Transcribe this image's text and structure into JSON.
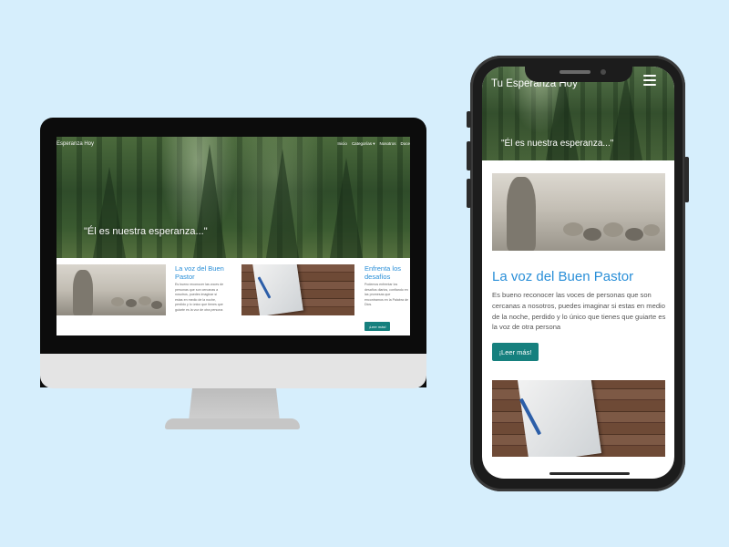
{
  "site": {
    "brand": "Tu Esperanza Hoy",
    "desktop_brand": "Esperanza Hoy",
    "hero_quote": "\"Él es nuestra esperanza...\""
  },
  "desktop_nav": [
    {
      "label": "Inicio"
    },
    {
      "label": "Categorías ▾"
    },
    {
      "label": "Nosotros"
    },
    {
      "label": "Doce"
    }
  ],
  "articles": [
    {
      "title": "La voz del Buen Pastor",
      "excerpt": "Es bueno reconocer las voces de personas que son cercanas a nosotros, puedes imaginar si estas en medio de la noche, perdido y lo único que tienes que guiarte es la voz de otra persona",
      "button": "¡Leer más!"
    },
    {
      "title": "Enfrenta los desafíos",
      "excerpt": "Podemos enfrentar los desafíos diarios, confiando en las promesas que encontramos en la Palabra de Dios.",
      "button": "¡Leer más!"
    }
  ],
  "colors": {
    "background": "#d6eefc",
    "link_blue": "#2a8fd8",
    "button_teal": "#16807e"
  },
  "icons": {
    "menu": "hamburger-menu-icon"
  }
}
